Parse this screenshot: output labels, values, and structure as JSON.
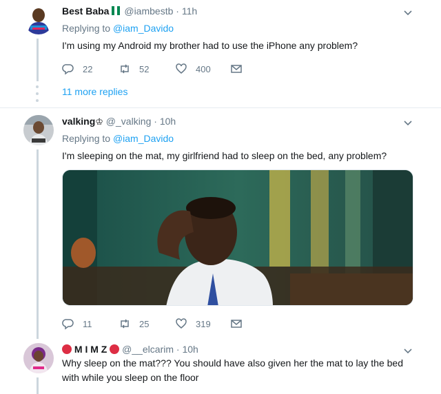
{
  "tweets": [
    {
      "name": "Best Baba",
      "handle": "@iambestb",
      "time": "· 11h",
      "reply_prefix": "Replying to ",
      "reply_handle": "@iam_Davido",
      "text": "I'm using my Android my brother had to use the iPhone any problem?",
      "replies": "22",
      "retweets": "52",
      "likes": "400",
      "more_replies": "11 more replies"
    },
    {
      "name": "valking",
      "handle": "@_valking",
      "time": "· 10h",
      "reply_prefix": "Replying to ",
      "reply_handle": "@iam_Davido",
      "text": "I'm sleeping on the mat, my girlfriend had to sleep on the bed, any problem?",
      "replies": "11",
      "retweets": "25",
      "likes": "319"
    },
    {
      "name": "M I M Z",
      "handle": "@__elcarim",
      "time": "· 10h",
      "text": "Why sleep on the mat??? You should have also given her the mat to lay the bed with while you sleep on the floor"
    }
  ],
  "icons": {
    "reply": "reply-icon",
    "retweet": "retweet-icon",
    "like": "heart-icon",
    "dm": "mail-icon",
    "more": "chevron-down-icon"
  },
  "colors": {
    "link": "#1da1f2",
    "muted": "#657786",
    "thread_line": "#ccd6dd"
  }
}
